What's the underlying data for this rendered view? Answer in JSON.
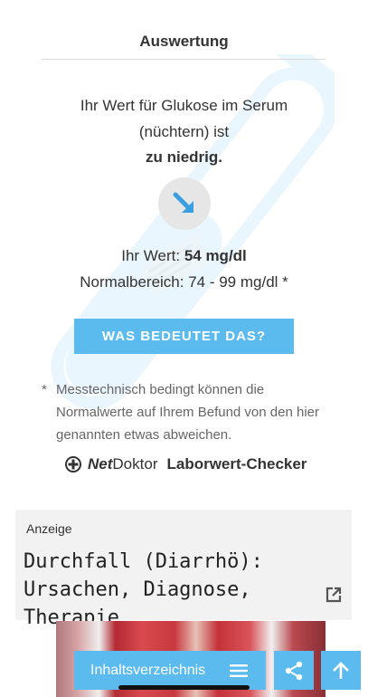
{
  "header": {
    "title": "Auswertung"
  },
  "result": {
    "line1": "Ihr Wert für Glukose im Serum",
    "line2": "(nüchtern) ist",
    "verdict": "zu niedrig."
  },
  "value": {
    "label": "Ihr Wert: ",
    "amount": "54 mg/dl",
    "normal": "Normalbereich: 74 - 99 mg/dl *"
  },
  "cta": {
    "label": "WAS BEDEUTET DAS?"
  },
  "footnote": {
    "star": "*",
    "text": "Messtechnisch bedingt können die Normalwerte auf Ihrem Befund von den hier genannten etwas abweichen."
  },
  "brand": {
    "logo_net": "Net",
    "logo_doktor": "Doktor",
    "title": "Laborwert-Checker"
  },
  "ad": {
    "label": "Anzeige",
    "title": "Durchfall (Diarrhö): Ursachen, Diagnose, Therapie"
  },
  "bottom_bar": {
    "toc_label": "Inhaltsverzeichnis"
  },
  "icons": {
    "arrow": "arrow-down-right-icon",
    "external": "external-link-icon",
    "menu": "menu-icon",
    "share": "share-icon",
    "up": "arrow-up-icon"
  },
  "colors": {
    "accent": "#5bbbef",
    "arrow": "#3a9fe0",
    "ad_bg": "#f2f2f2"
  }
}
